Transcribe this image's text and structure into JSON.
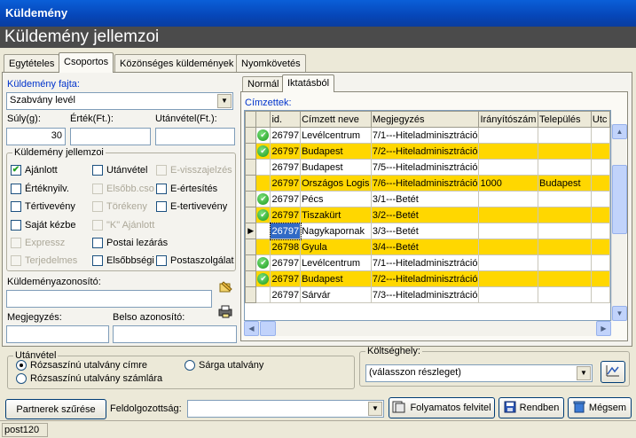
{
  "window": {
    "title": "Küldemény"
  },
  "header": {
    "title": "Küldemény jellemzoi"
  },
  "main_tabs": [
    {
      "label": "Egytételes"
    },
    {
      "label": "Csoportos"
    },
    {
      "label": "Közönséges küldemények"
    },
    {
      "label": "Nyomkövetés"
    }
  ],
  "left": {
    "kind_label": "Küldemény fajta:",
    "kind_value": "Szabvány levél",
    "weight_label": "Súly(g):",
    "weight_value": "30",
    "value_label": "Érték(Ft.):",
    "value_value": "",
    "cod_label": "Utánvétel(Ft.):",
    "cod_value": "",
    "features_title": "Küldemény jellemzoi",
    "features": [
      {
        "label": "Ajánlott",
        "checked": true,
        "disabled": false
      },
      {
        "label": "Utánvétel",
        "checked": false,
        "disabled": false
      },
      {
        "label": "E-visszajelzés",
        "checked": false,
        "disabled": true
      },
      {
        "label": "Értéknyilv.",
        "checked": false,
        "disabled": false
      },
      {
        "label": "Elsőbb.cso",
        "checked": false,
        "disabled": true
      },
      {
        "label": "E-értesítés",
        "checked": false,
        "disabled": false
      },
      {
        "label": "Tértivevény",
        "checked": false,
        "disabled": false
      },
      {
        "label": "Törékeny",
        "checked": false,
        "disabled": true
      },
      {
        "label": "E-tertivevény",
        "checked": false,
        "disabled": false
      },
      {
        "label": "Saját kézbe",
        "checked": false,
        "disabled": false
      },
      {
        "label": "\"K\" Ajánlott",
        "checked": false,
        "disabled": true
      },
      {
        "label": "Expressz",
        "checked": false,
        "disabled": true
      },
      {
        "label": "Postai lezárás",
        "checked": false,
        "disabled": false
      },
      {
        "label": "Terjedelmes",
        "checked": false,
        "disabled": true
      },
      {
        "label": "Elsőbbségi",
        "checked": false,
        "disabled": false
      },
      {
        "label": "Postaszolgálat",
        "checked": false,
        "disabled": false
      }
    ],
    "shipment_id_label": "Küldeményazonosító:",
    "shipment_id_value": "",
    "note_label": "Megjegyzés:",
    "note_value": "",
    "internal_id_label": "Belso azonosító:",
    "internal_id_value": ""
  },
  "right": {
    "tabs": [
      {
        "label": "Normál"
      },
      {
        "label": "Iktatásból"
      }
    ],
    "recipients_label": "Címzettek:",
    "columns": [
      "",
      "id.",
      "Címzett neve",
      "Megjegyzés",
      "Irányítószám",
      "Település",
      "Utc"
    ],
    "rows": [
      {
        "ok": true,
        "highlight": false,
        "id": "26797",
        "name": "Levélcentrum",
        "note": "7/1---Hiteladminisztráció",
        "zip": "",
        "city": ""
      },
      {
        "ok": true,
        "highlight": true,
        "id": "26797",
        "name": "Budapest",
        "note": "7/2---Hiteladminisztráció",
        "zip": "",
        "city": ""
      },
      {
        "ok": false,
        "highlight": false,
        "id": "26797",
        "name": "Budapest",
        "note": "7/5---Hiteladminisztráció",
        "zip": "",
        "city": ""
      },
      {
        "ok": false,
        "highlight": true,
        "id": "26797",
        "name": "Országos Logis",
        "note": "7/6---Hiteladminisztráció",
        "zip": "1000",
        "city": "Budapest"
      },
      {
        "ok": true,
        "highlight": false,
        "id": "26797",
        "name": "Pécs",
        "note": "3/1---Betét",
        "zip": "",
        "city": ""
      },
      {
        "ok": true,
        "highlight": true,
        "id": "26797",
        "name": "Tiszakürt",
        "note": "3/2---Betét",
        "zip": "",
        "city": ""
      },
      {
        "ok": false,
        "highlight": false,
        "id": "26797",
        "name": "Nagykapornak",
        "note": "3/3---Betét",
        "zip": "",
        "city": "",
        "current": true
      },
      {
        "ok": false,
        "highlight": true,
        "id": "26798",
        "name": "Gyula",
        "note": "3/4---Betét",
        "zip": "",
        "city": ""
      },
      {
        "ok": true,
        "highlight": false,
        "id": "26797",
        "name": "Levélcentrum",
        "note": "7/1---Hiteladminisztráció",
        "zip": "",
        "city": ""
      },
      {
        "ok": true,
        "highlight": true,
        "id": "26797",
        "name": "Budapest",
        "note": "7/2---Hiteladminisztráció",
        "zip": "",
        "city": ""
      },
      {
        "ok": false,
        "highlight": false,
        "id": "26797",
        "name": "Sárvár",
        "note": "7/3---Hiteladminisztráció",
        "zip": "",
        "city": ""
      }
    ]
  },
  "cod_group": {
    "title": "Utánvétel",
    "options": [
      {
        "label": "Rózsaszínú utalvány címre",
        "selected": true
      },
      {
        "label": "Sárga utalvány",
        "selected": false
      },
      {
        "label": "Rózsaszínú utalvány számlára",
        "selected": false
      }
    ]
  },
  "cost_center": {
    "title": "Költséghely:",
    "value": "(válasszon részleget)"
  },
  "bottom": {
    "partner_filter": "Partnerek szűrése",
    "processed_label": "Feldolgozottság:",
    "processed_value": "",
    "continuous_button": "Folyamatos felvitel",
    "ok_button": "Rendben",
    "cancel_button": "Mégsem"
  },
  "status": {
    "text": "post120"
  }
}
